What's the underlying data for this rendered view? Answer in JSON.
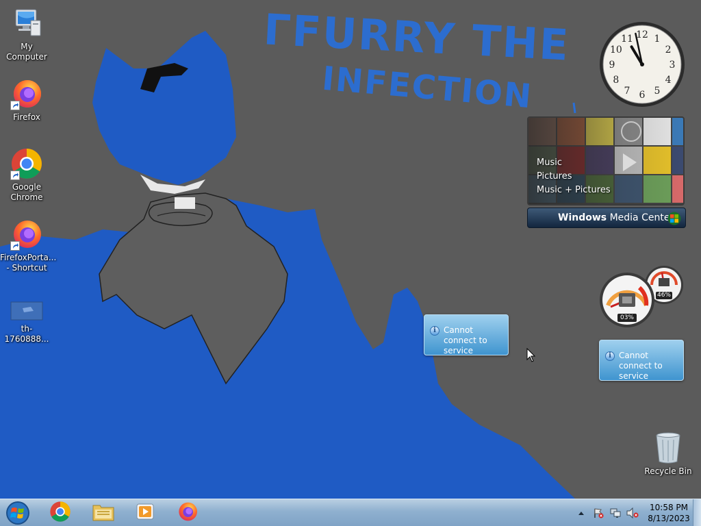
{
  "wallpaper": {
    "title_line1": "ΓFURRY THE",
    "title_line2": "INFECTION"
  },
  "desktop_icons": [
    {
      "label": "My Computer",
      "icon": "computer-icon"
    },
    {
      "label": "Firefox",
      "icon": "firefox-icon"
    },
    {
      "label": "Google Chrome",
      "icon": "chrome-icon"
    },
    {
      "label": "FirefoxPorta... - Shortcut",
      "icon": "firefox-portable-icon"
    },
    {
      "label": "th-1760888...",
      "icon": "image-file-icon"
    }
  ],
  "recycle_bin": {
    "label": "Recycle Bin",
    "icon": "recycle-bin-icon"
  },
  "clock_gadget": {
    "time": "10:58",
    "hours": [
      "12",
      "1",
      "2",
      "3",
      "4",
      "5",
      "6",
      "7",
      "8",
      "9",
      "10",
      "11"
    ]
  },
  "media_center": {
    "menu_items": [
      "Music",
      "Pictures",
      "Music + Pictures"
    ],
    "brand_bold": "Windows",
    "brand_light": "Media Center"
  },
  "cpu_meter": {
    "cpu_percent": "03%",
    "memory_percent": "46%"
  },
  "notices": [
    {
      "text": "Cannot connect to service",
      "icon": "info-icon"
    },
    {
      "text": "Cannot connect to service",
      "icon": "info-icon"
    }
  ],
  "taskbar": {
    "pinned": [
      "chrome-icon",
      "explorer-icon",
      "media-player-icon",
      "firefox-icon"
    ],
    "clock_time": "10:58 PM",
    "clock_date": "8/13/2023"
  },
  "colors": {
    "accent_blue": "#1f5bc4",
    "taskbar": "#9bb8d4",
    "notice": "#5aa7dc"
  }
}
